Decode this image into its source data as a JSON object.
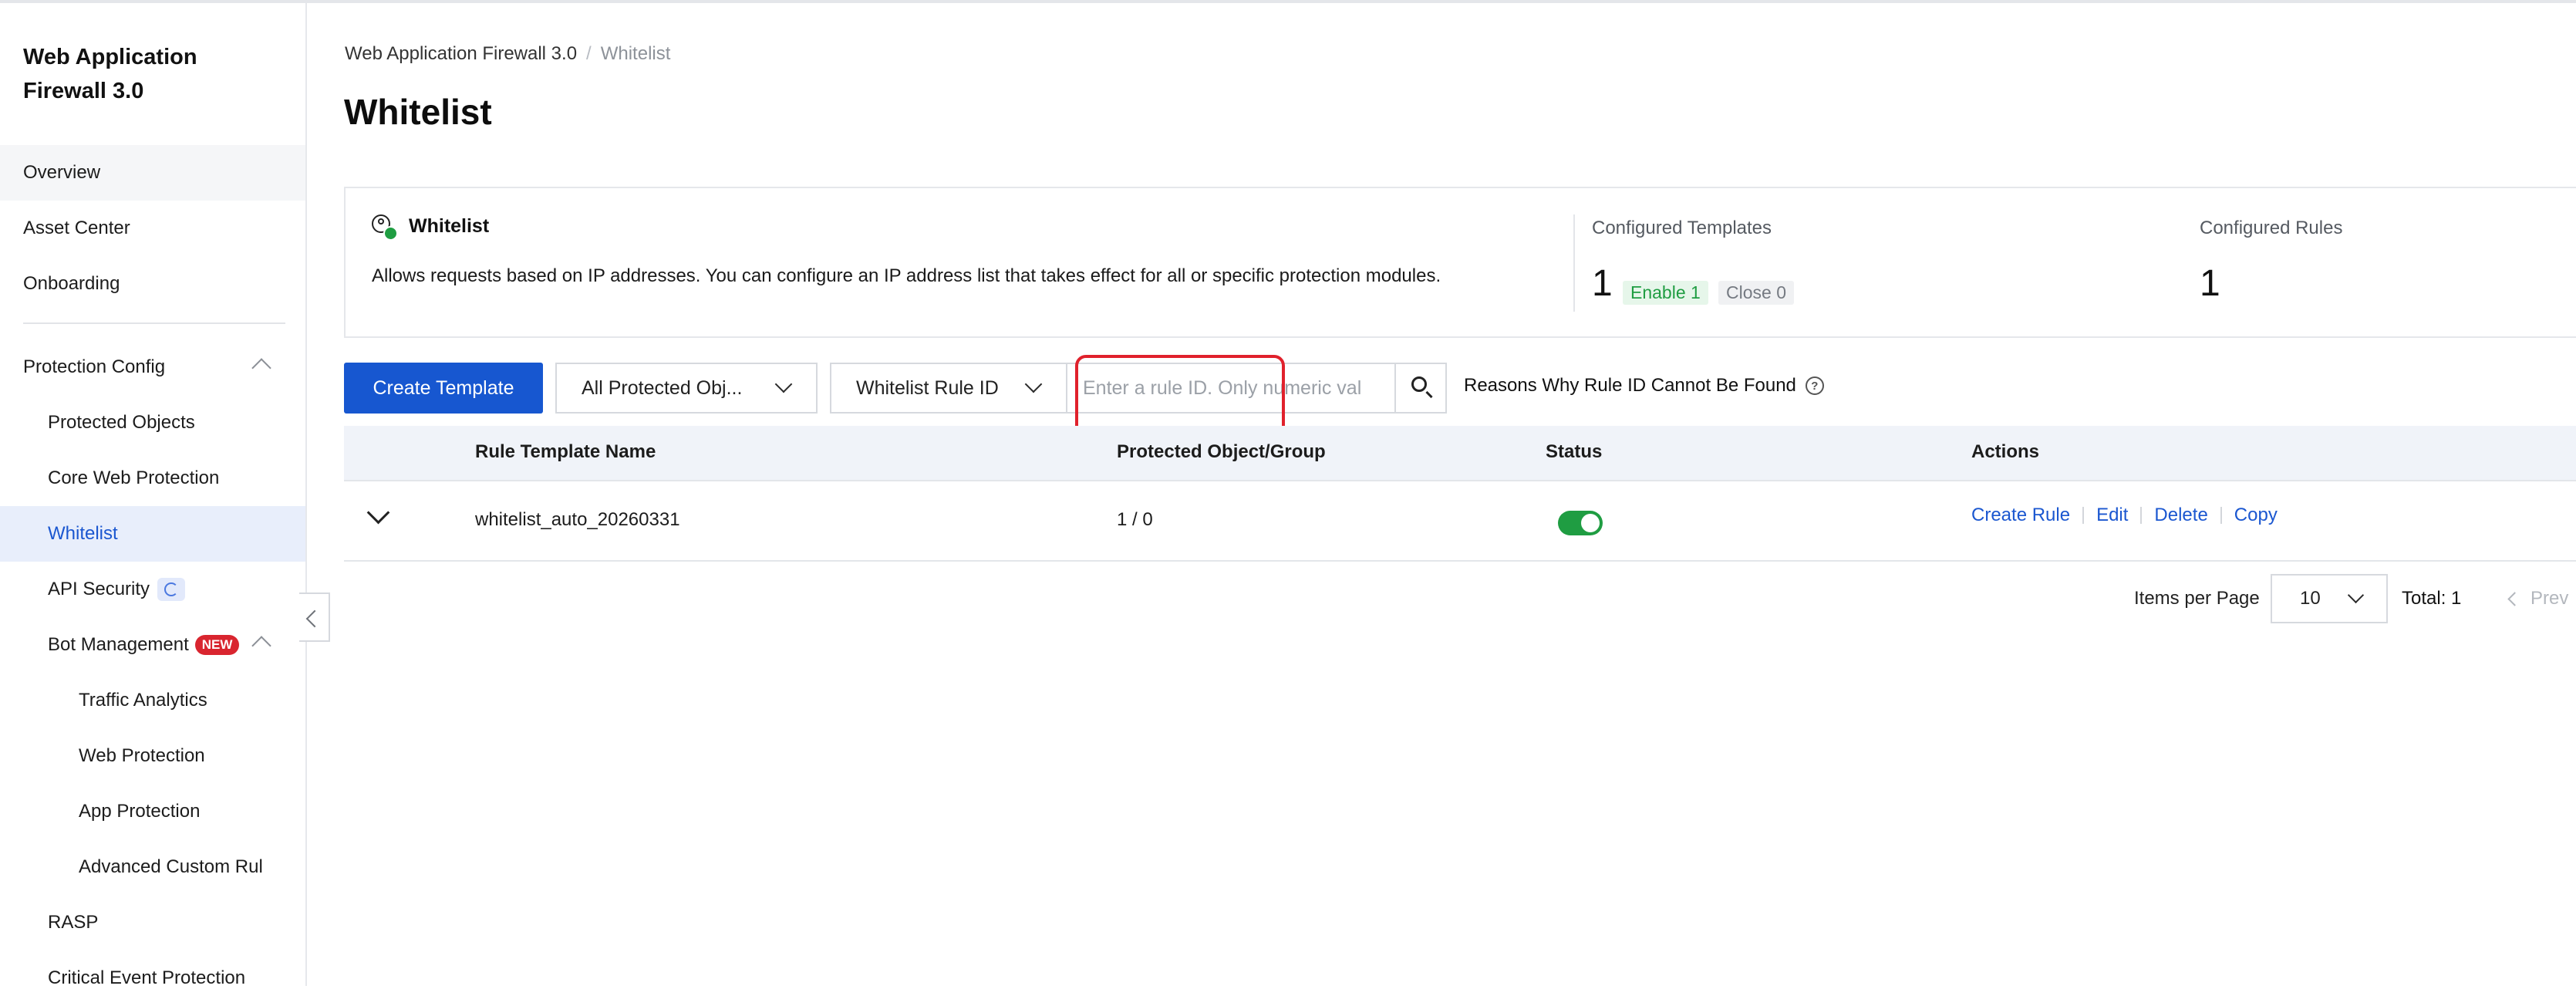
{
  "sidebar": {
    "title": "Web Application Firewall 3.0",
    "items": [
      {
        "label": "Overview"
      },
      {
        "label": "Asset Center"
      },
      {
        "label": "Onboarding"
      },
      {
        "label": "Protection Config"
      },
      {
        "label": "Protected Objects"
      },
      {
        "label": "Core Web Protection"
      },
      {
        "label": "Whitelist"
      },
      {
        "label": "API Security"
      },
      {
        "label": "Bot Management",
        "badge": "NEW"
      },
      {
        "label": "Traffic Analytics"
      },
      {
        "label": "Web Protection"
      },
      {
        "label": "App Protection"
      },
      {
        "label": "Advanced Custom Rul"
      },
      {
        "label": "RASP"
      },
      {
        "label": "Critical Event Protection"
      }
    ]
  },
  "breadcrumb": {
    "root": "Web Application Firewall 3.0",
    "current": "Whitelist"
  },
  "page_title": "Whitelist",
  "info_card": {
    "title": "Whitelist",
    "description": "Allows requests based on IP addresses. You can configure an IP address list that takes effect for all or specific protection modules.",
    "configured_templates_label": "Configured Templates",
    "configured_templates_value": "1",
    "enable_tag": "Enable 1",
    "close_tag": "Close 0",
    "configured_rules_label": "Configured Rules",
    "configured_rules_value": "1"
  },
  "toolbar": {
    "create_template": "Create Template",
    "object_filter": "All Protected Obj...",
    "search_type": "Whitelist Rule ID",
    "search_placeholder": "Enter a rule ID. Only numeric val",
    "reasons_link": "Reasons Why Rule ID Cannot Be Found",
    "help_glyph": "?"
  },
  "table": {
    "headers": [
      "Rule Template Name",
      "Protected Object/Group",
      "Status",
      "Actions"
    ],
    "rows": [
      {
        "name": "whitelist_auto_20260331",
        "objects": "1 / 0",
        "status_on": true,
        "actions": [
          "Create Rule",
          "Edit",
          "Delete",
          "Copy"
        ]
      }
    ]
  },
  "pagination": {
    "items_per_page_label": "Items per Page",
    "page_size": "10",
    "total": "Total: 1",
    "prev": "Prev"
  },
  "colors": {
    "primary": "#1757d0",
    "success": "#1f9d42",
    "highlight": "#e0212c"
  }
}
